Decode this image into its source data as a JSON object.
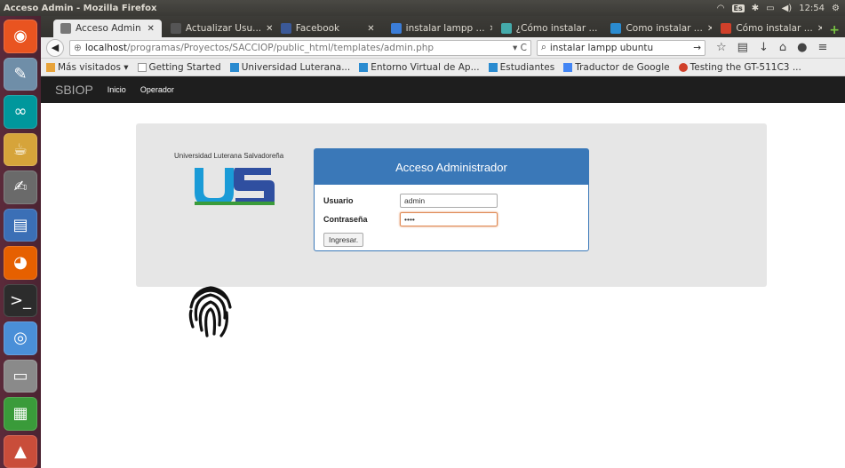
{
  "os": {
    "window_title": "Acceso Admin - Mozilla Firefox",
    "tray": {
      "keyboard": "Es",
      "clock": "12:54"
    },
    "launcher": [
      {
        "name": "dash-icon"
      },
      {
        "name": "files-icon"
      },
      {
        "name": "arduino-icon"
      },
      {
        "name": "teapot-icon"
      },
      {
        "name": "text-editor-icon"
      },
      {
        "name": "document-icon"
      },
      {
        "name": "firefox-icon"
      },
      {
        "name": "terminal-icon"
      },
      {
        "name": "chromium-icon"
      },
      {
        "name": "file-manager-icon"
      },
      {
        "name": "spreadsheet-icon"
      },
      {
        "name": "presentation-icon"
      }
    ]
  },
  "browser": {
    "tabs": [
      {
        "label": "Acceso Admin",
        "color": "#777"
      },
      {
        "label": "Actualizar Usu...",
        "color": "#555"
      },
      {
        "label": "Facebook",
        "color": "#3b5998"
      },
      {
        "label": "instalar lampp ...",
        "color": "#3b7dd8"
      },
      {
        "label": "¿Cómo instalar ...",
        "color": "#4aa"
      },
      {
        "label": "Como instalar ...",
        "color": "#2a8bd0"
      },
      {
        "label": "Cómo instalar ...",
        "color": "#d0402a"
      }
    ],
    "url": {
      "host": "localhost",
      "path": "/programas/Proyectos/SACCIOP/public_html/templates/admin.php"
    },
    "search": "instalar lampp ubuntu",
    "bookmarks": [
      {
        "label": "Más visitados ▾",
        "color": "#e8a33a"
      },
      {
        "label": "Getting Started",
        "color": "#ddd"
      },
      {
        "label": "Universidad Luterana...",
        "color": "#2a8bd0"
      },
      {
        "label": "Entorno Virtual de Ap...",
        "color": "#2a8bd0"
      },
      {
        "label": "Estudiantes",
        "color": "#2a8bd0"
      },
      {
        "label": "Traductor de Google",
        "color": "#4285f4"
      },
      {
        "label": "Testing the GT-511C3 ...",
        "color": "#d0402a"
      }
    ]
  },
  "app": {
    "brand": "SBIOP",
    "nav": [
      "Inicio",
      "Operador"
    ],
    "university": "Universidad Luterana Salvadoreña",
    "panel_title": "Acceso Administrador",
    "user_label": "Usuario",
    "user_value": "admin",
    "pass_label": "Contraseña",
    "pass_value": "••••",
    "submit": "Ingresar."
  }
}
